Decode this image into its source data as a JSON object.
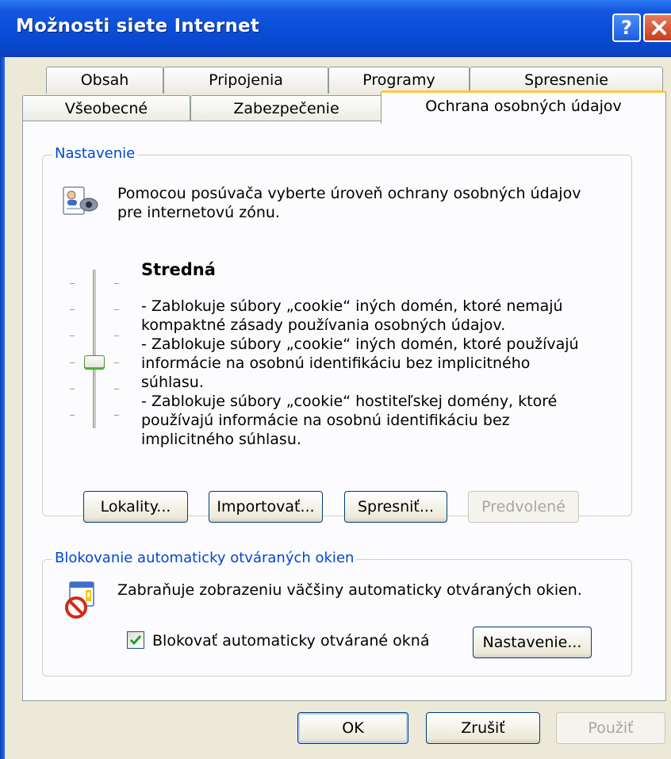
{
  "window": {
    "title": "Možnosti siete Internet",
    "help_glyph": "?",
    "close_icon": "close-icon",
    "accent_color": "#0a4ed8"
  },
  "tabs": {
    "row1": [
      "Obsah",
      "Pripojenia",
      "Programy",
      "Spresnenie"
    ],
    "row2": [
      "Všeobecné",
      "Zabezpečenie",
      "Ochrana osobných údajov"
    ],
    "active": "Ochrana osobných údajov"
  },
  "settings": {
    "group_title": "Nastavenie",
    "intro": "Pomocou posúvača vyberte úroveň ochrany osobných údajov pre internetovú zónu.",
    "level_title": "Stredná",
    "slider_positions": 6,
    "slider_selected_index": 3,
    "description_lines": [
      "- Zablokuje súbory „cookie“ iných domén, ktoré nemajú",
      "kompaktné zásady používania osobných údajov.",
      "- Zablokuje súbory „cookie“ iných domén, ktoré používajú",
      "informácie na osobnú identifikáciu bez implicitného",
      "súhlasu.",
      "- Zablokuje súbory „cookie“ hostiteľskej domény, ktoré",
      "používajú informácie na osobnú identifikáciu bez",
      "implicitného súhlasu."
    ],
    "buttons": {
      "sites": "Lokality...",
      "import": "Importovať...",
      "advanced": "Spresniť...",
      "default": "Predvolené"
    }
  },
  "popup": {
    "group_title": "Blokovanie automaticky otváraných okien",
    "description": "Zabraňuje zobrazeniu väčšiny automaticky otváraných okien.",
    "checkbox_label": "Blokovať automaticky otvárané okná",
    "checkbox_checked": true,
    "settings_button": "Nastavenie..."
  },
  "footer": {
    "ok": "OK",
    "cancel": "Zrušiť",
    "apply": "Použiť"
  }
}
